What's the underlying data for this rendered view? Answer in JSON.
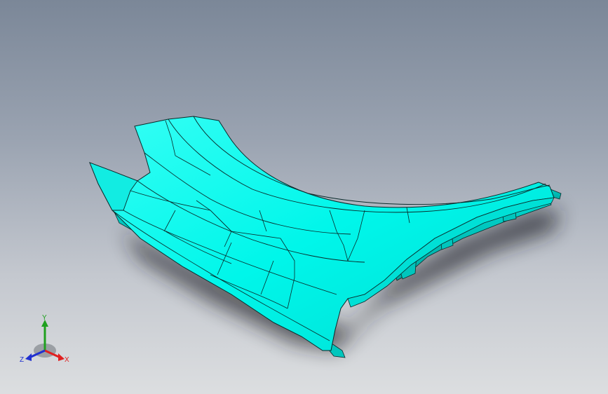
{
  "viewport": {
    "background_top": "#7b8798",
    "background_bottom": "#dcdee0"
  },
  "model": {
    "surface_color": "#00fff2",
    "edge_color": "#0a2a2a"
  },
  "triad": {
    "x_label": "X",
    "y_label": "Y",
    "z_label": "Z",
    "x_color": "#e02020",
    "y_color": "#1fa01f",
    "z_color": "#2030d0"
  }
}
